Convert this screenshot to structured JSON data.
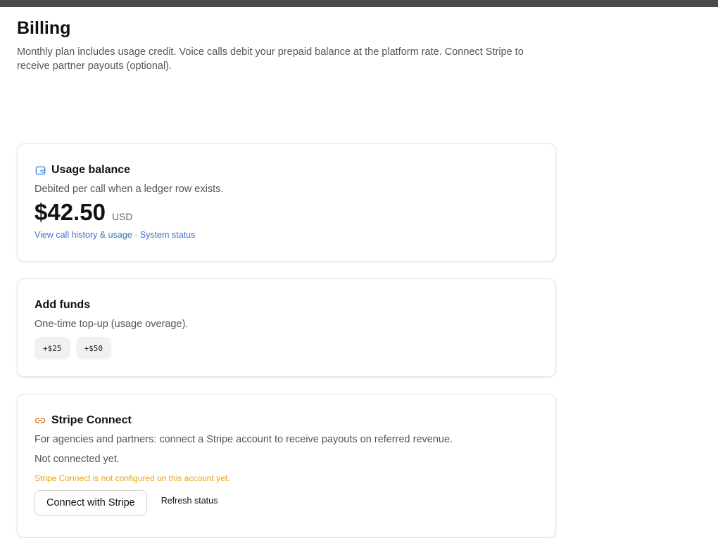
{
  "page": {
    "title": "Billing",
    "description": "Monthly plan includes usage credit. Voice calls debit your prepaid balance at the platform rate. Connect Stripe to receive partner payouts (optional)."
  },
  "usage": {
    "title": "Usage balance",
    "icon": "wallet-icon",
    "subtitle": "Debited per call when a ledger row exists.",
    "amount": "$42.50",
    "currency": "USD",
    "link_history": "View call history & usage",
    "separator": "·",
    "link_status": "System status"
  },
  "funds": {
    "title": "Add funds",
    "subtitle": "One-time top-up (usage overage).",
    "options": [
      "+$25",
      "+$50"
    ]
  },
  "stripe": {
    "title": "Stripe Connect",
    "icon": "link-icon",
    "subtitle": "For agencies and partners: connect a Stripe account to receive payouts on referred revenue.",
    "status": "Not connected yet.",
    "warning": "Stripe Connect is not configured on this account yet.",
    "connect_label": "Connect with Stripe",
    "refresh_label": "Refresh status"
  },
  "colors": {
    "link": "#3b73c8",
    "warning": "#e8a317",
    "wallet_icon": "#4a86e8",
    "link_icon": "#e8772e"
  }
}
